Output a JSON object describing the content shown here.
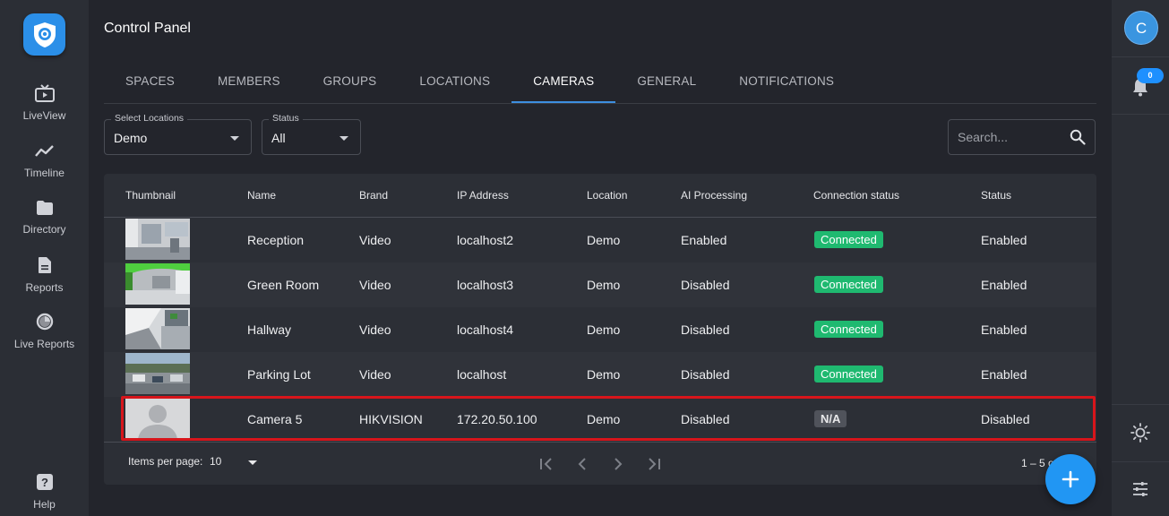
{
  "sidebar": {
    "items": [
      {
        "label": "LiveView",
        "icon": "tv-icon"
      },
      {
        "label": "Timeline",
        "icon": "timeline-icon"
      },
      {
        "label": "Directory",
        "icon": "folder-icon"
      },
      {
        "label": "Reports",
        "icon": "document-icon"
      },
      {
        "label": "Live Reports",
        "icon": "pie-chart-icon"
      }
    ],
    "help_label": "Help"
  },
  "header": {
    "title": "Control Panel"
  },
  "tabs": [
    {
      "label": "SPACES"
    },
    {
      "label": "MEMBERS"
    },
    {
      "label": "GROUPS"
    },
    {
      "label": "LOCATIONS"
    },
    {
      "label": "CAMERAS",
      "active": true
    },
    {
      "label": "GENERAL"
    },
    {
      "label": "NOTIFICATIONS"
    }
  ],
  "filters": {
    "location": {
      "label": "Select Locations",
      "value": "Demo"
    },
    "status": {
      "label": "Status",
      "value": "All"
    },
    "search_placeholder": "Search..."
  },
  "table": {
    "columns": [
      "Thumbnail",
      "Name",
      "Brand",
      "IP Address",
      "Location",
      "AI Processing",
      "Connection status",
      "Status"
    ],
    "rows": [
      {
        "name": "Reception",
        "brand": "Video",
        "ip": "localhost2",
        "location": "Demo",
        "ai": "Enabled",
        "connection": "Connected",
        "status": "Enabled"
      },
      {
        "name": "Green Room",
        "brand": "Video",
        "ip": "localhost3",
        "location": "Demo",
        "ai": "Disabled",
        "connection": "Connected",
        "status": "Enabled"
      },
      {
        "name": "Hallway",
        "brand": "Video",
        "ip": "localhost4",
        "location": "Demo",
        "ai": "Disabled",
        "connection": "Connected",
        "status": "Enabled"
      },
      {
        "name": "Parking Lot",
        "brand": "Video",
        "ip": "localhost",
        "location": "Demo",
        "ai": "Disabled",
        "connection": "Connected",
        "status": "Enabled"
      },
      {
        "name": "Camera 5",
        "brand": "HIKVISION",
        "ip": "172.20.50.100",
        "location": "Demo",
        "ai": "Disabled",
        "connection": "N/A",
        "status": "Disabled"
      }
    ]
  },
  "pagination": {
    "items_per_page_label": "Items per page:",
    "items_per_page": "10",
    "range": "1 – 5 o"
  },
  "right_rail": {
    "avatar_initial": "C",
    "notification_count": "0"
  },
  "colors": {
    "accent": "#2196f3",
    "connected": "#1fb970",
    "highlight": "#d7151b"
  }
}
